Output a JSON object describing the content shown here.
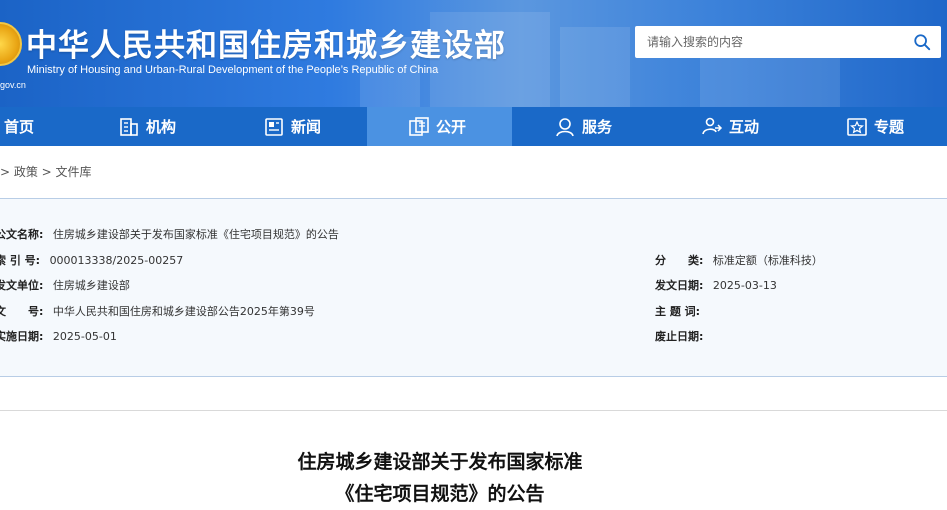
{
  "header": {
    "title": "中华人民共和国住房和城乡建设部",
    "subtitle": "Ministry of Housing and Urban-Rural Development of the People’s Republic of China",
    "domain": "gov.cn",
    "search_placeholder": "请输入搜索的内容"
  },
  "nav": {
    "items": [
      {
        "label": "首页",
        "icon": "home-icon"
      },
      {
        "label": "机构",
        "icon": "building-icon"
      },
      {
        "label": "新闻",
        "icon": "news-icon"
      },
      {
        "label": "公开",
        "icon": "disclosure-icon"
      },
      {
        "label": "服务",
        "icon": "service-icon"
      },
      {
        "label": "互动",
        "icon": "interaction-icon"
      },
      {
        "label": "专题",
        "icon": "topic-icon"
      }
    ],
    "active_index": 3
  },
  "breadcrumb": "> 政策 > 文件库",
  "meta": {
    "title_label": "公文名称:",
    "title_value": "住房城乡建设部关于发布国家标准《住宅项目规范》的公告",
    "index_label": "索 引 号:",
    "index_value": "000013338/2025-00257",
    "category_label": "分　　类:",
    "category_value": "标准定额（标准科技）",
    "issuer_label": "发文单位:",
    "issuer_value": "住房城乡建设部",
    "date_label": "发文日期:",
    "date_value": "2025-03-13",
    "docno_label": "文　　号:",
    "docno_value": "中华人民共和国住房和城乡建设部公告2025年第39号",
    "keywords_label": "主 题 词:",
    "keywords_value": "",
    "effective_label": "实施日期:",
    "effective_value": "2025-05-01",
    "expiry_label": "废止日期:",
    "expiry_value": ""
  },
  "article": {
    "title_line1": "住房城乡建设部关于发布国家标准",
    "title_line2": "《住宅项目规范》的公告"
  },
  "colors": {
    "nav_bg": "#1a69c8",
    "nav_active": "#4b92e2",
    "meta_bg": "#f5f9fd"
  }
}
